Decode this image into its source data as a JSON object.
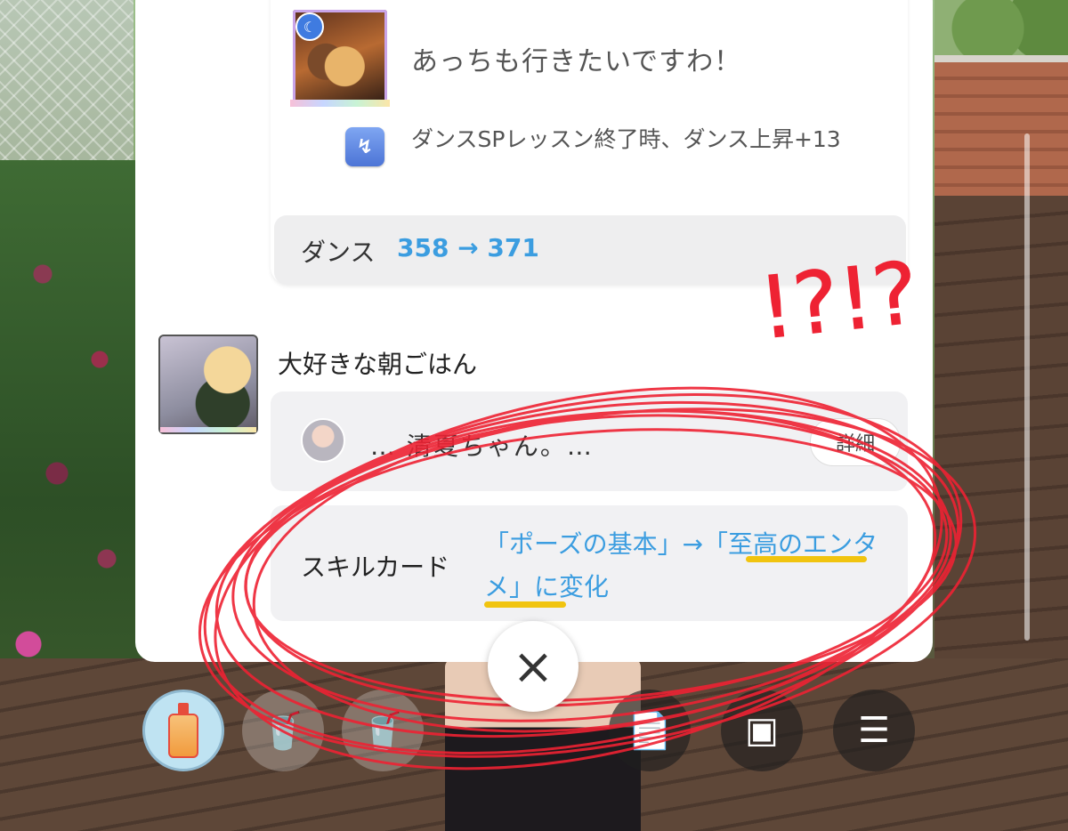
{
  "card": {
    "title": "あっちも行きたいですわ！",
    "badge_icon": "rest-icon",
    "effect_text": "ダンスSPレッスン終了時、ダンス上昇+13",
    "stat_label": "ダンス",
    "stat_value": "358 → 371"
  },
  "event": {
    "title": "大好きな朝ごはん",
    "snippet": "… 清夏ちゃん。…",
    "detail_label": "詳細"
  },
  "skill": {
    "label": "スキルカード",
    "change_text": "「ポーズの基本」→「至高のエンタメ」に変化"
  },
  "scribble_text": "!?!?",
  "close_label": "×",
  "toolbar": {
    "items": [
      {
        "name": "drink-slot",
        "icon": "bottle-icon",
        "glyph": ""
      },
      {
        "name": "cup-slot-1",
        "icon": "cup-icon",
        "glyph": "🥤"
      },
      {
        "name": "cup-slot-2",
        "icon": "cup-icon",
        "glyph": "🥤"
      },
      {
        "name": "memo",
        "icon": "document-icon",
        "glyph": "📄"
      },
      {
        "name": "item-box",
        "icon": "box-icon",
        "glyph": "▣"
      },
      {
        "name": "menu",
        "icon": "hamburger-icon",
        "glyph": "☰"
      }
    ]
  },
  "colors": {
    "accent_blue": "#3b9de0",
    "highlight_yellow": "#f1c40f",
    "scribble_red": "#ee2233"
  }
}
